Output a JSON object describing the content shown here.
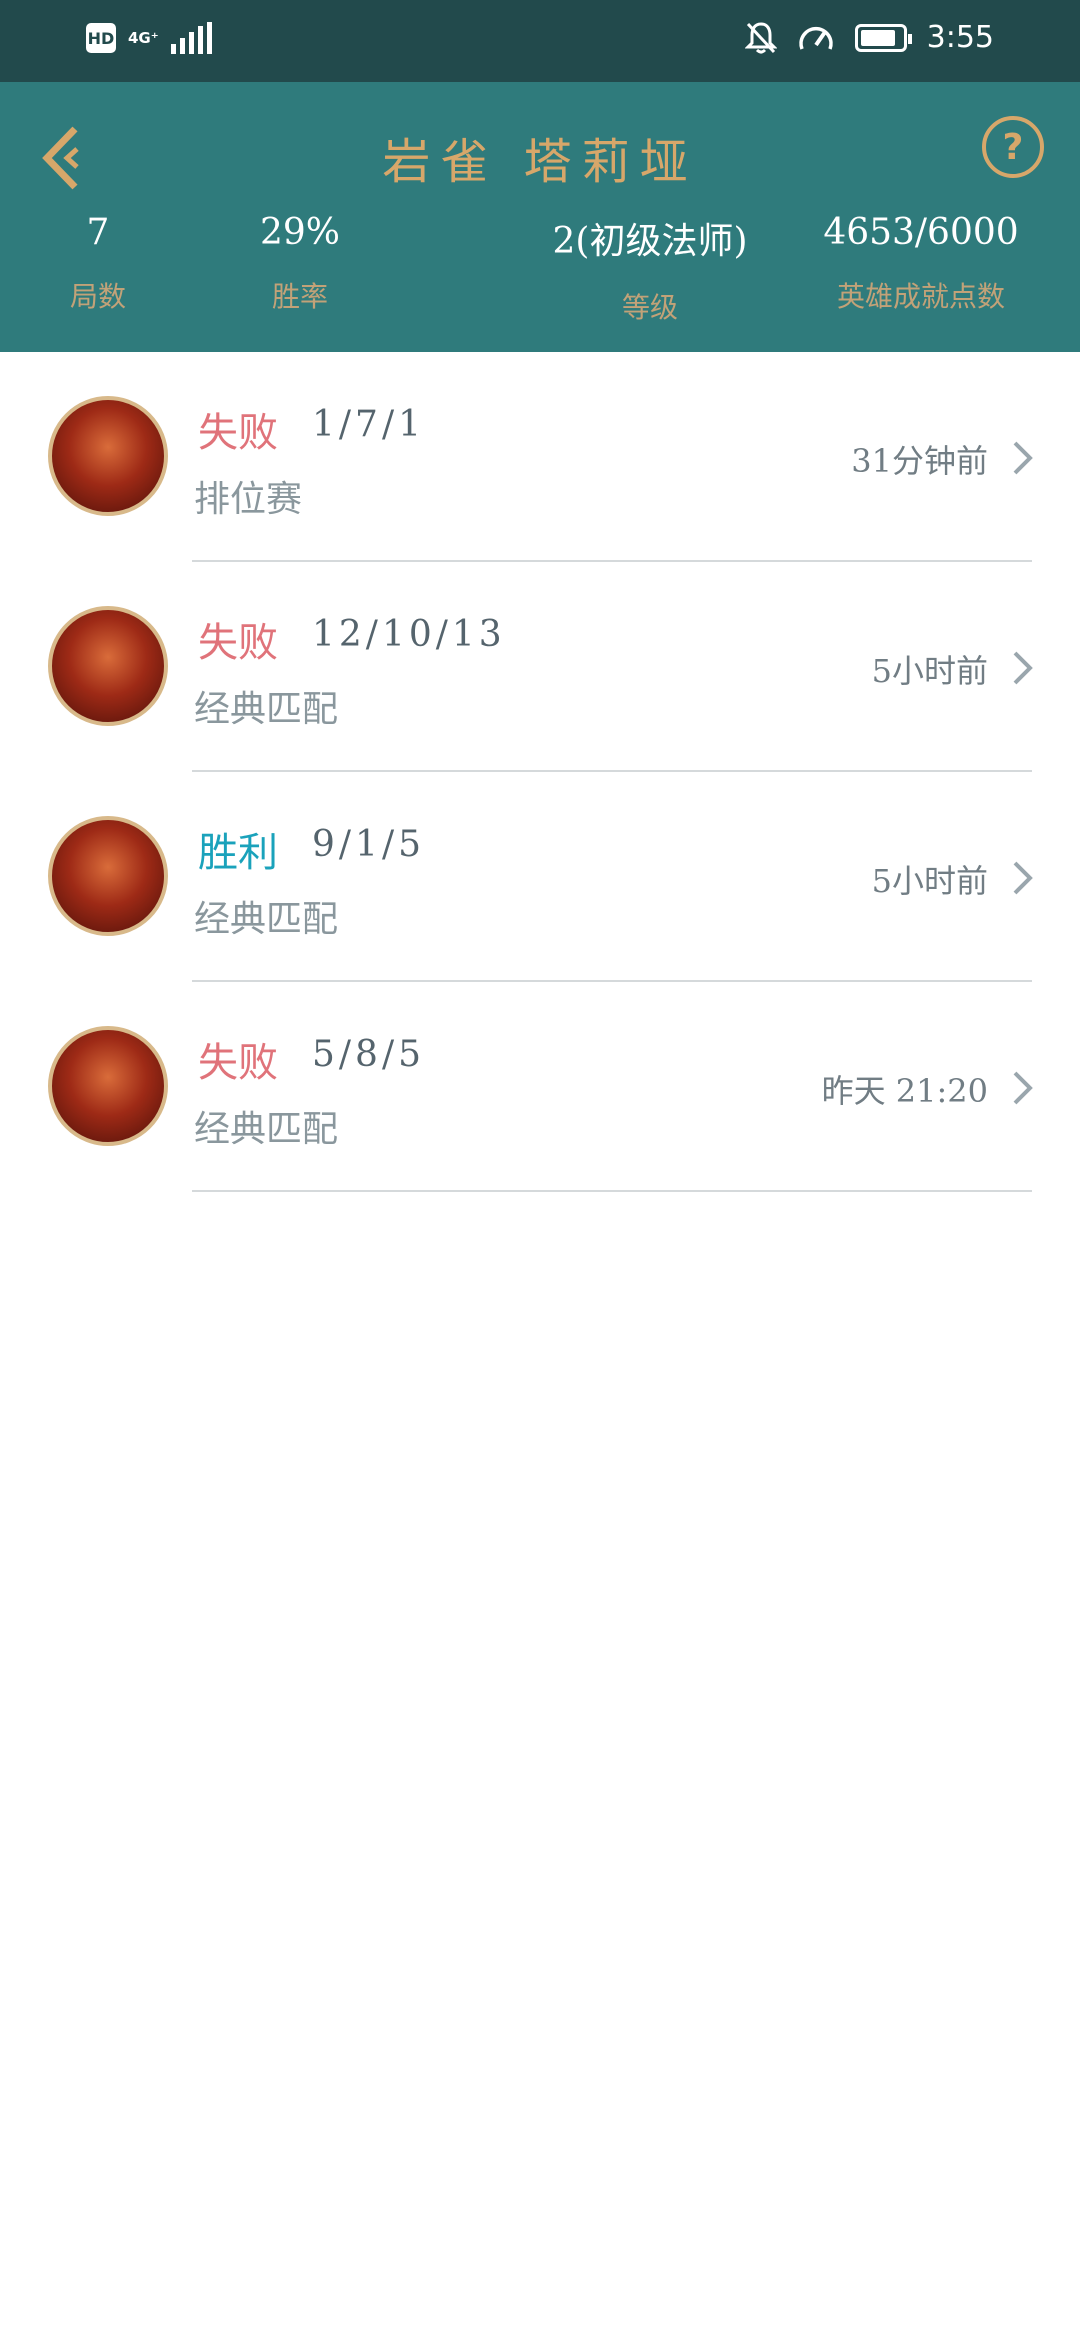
{
  "status_bar": {
    "hd_label": "HD",
    "network_label": "4G⁺",
    "time": "3:55",
    "battery_level": 0.85,
    "icons": [
      "hd-icon",
      "signal-icon",
      "mute-bell-icon",
      "speedometer-icon",
      "battery-icon"
    ]
  },
  "header": {
    "title": "岩雀 塔莉垭",
    "back_icon": "chevron-left-icon",
    "help_icon": "question-icon",
    "help_symbol": "?",
    "stats": [
      {
        "value": "7",
        "label": "局数"
      },
      {
        "value": "29%",
        "label": "胜率"
      },
      {
        "value": "2(初级法师)",
        "label": "等级"
      },
      {
        "value": "4653/6000",
        "label": "英雄成就点数"
      }
    ]
  },
  "colors": {
    "status_bar_bg": "#224a4c",
    "header_bg": "#2f7b7c",
    "accent_gold": "#d7a76a",
    "loss": "#e0737a",
    "win": "#1aa2bb"
  },
  "matches": [
    {
      "result": "失败",
      "outcome": "loss",
      "kda": "1/7/1",
      "mode": "排位赛",
      "time": "31分钟前"
    },
    {
      "result": "失败",
      "outcome": "loss",
      "kda": "12/10/13",
      "mode": "经典匹配",
      "time": "5小时前"
    },
    {
      "result": "胜利",
      "outcome": "win",
      "kda": "9/1/5",
      "mode": "经典匹配",
      "time": "5小时前"
    },
    {
      "result": "失败",
      "outcome": "loss",
      "kda": "5/8/5",
      "mode": "经典匹配",
      "time": "昨天 21:20"
    }
  ]
}
